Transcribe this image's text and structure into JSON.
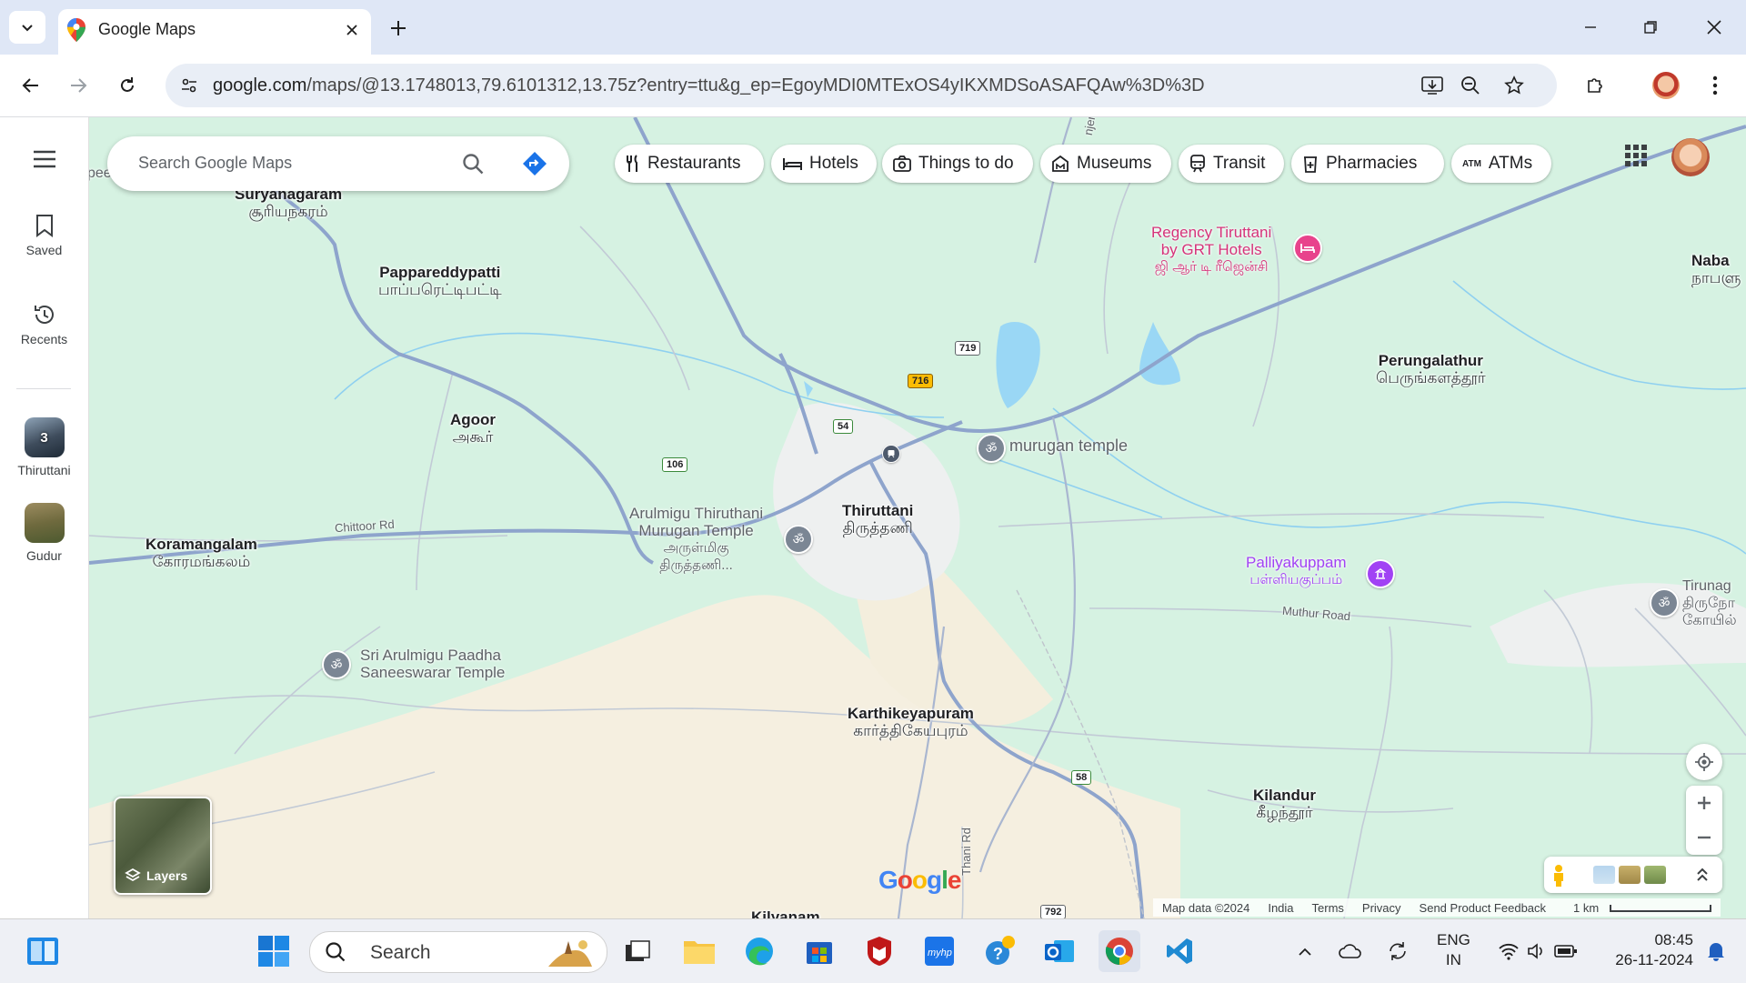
{
  "browser": {
    "tab_title": "Google Maps",
    "url_host": "google.com",
    "url_rest": "/maps/@13.1748013,79.6101312,13.75z?entry=ttu&g_ep=EgoyMDI0MTExOS4yIKXMDSoASAFQAw%3D%3D"
  },
  "rail": {
    "saved_label": "Saved",
    "recents_label": "Recents",
    "recent_places": [
      {
        "label": "Thiruttani",
        "count": "3"
      },
      {
        "label": "Gudur"
      }
    ]
  },
  "search": {
    "placeholder": "Search Google Maps"
  },
  "chips": [
    {
      "label": "Restaurants",
      "icon": "fork-knife-icon"
    },
    {
      "label": "Hotels",
      "icon": "bed-icon"
    },
    {
      "label": "Things to do",
      "icon": "camera-icon"
    },
    {
      "label": "Museums",
      "icon": "museum-icon"
    },
    {
      "label": "Transit",
      "icon": "train-icon"
    },
    {
      "label": "Pharmacies",
      "icon": "pharmacy-icon"
    },
    {
      "label": "ATMs",
      "icon": "atm-icon"
    }
  ],
  "map": {
    "places": [
      {
        "en": "Suryanagaram",
        "ta": "சூரியநகரம்"
      },
      {
        "en": "Pappareddypatti",
        "ta": "பாப்பரெட்டிபட்டி"
      },
      {
        "en": "Agoor",
        "ta": "அகூர்"
      },
      {
        "en": "Koramangalam",
        "ta": "கோரமங்கலம்"
      },
      {
        "en": "Thiruttani",
        "ta": "திருத்தணி"
      },
      {
        "en": "Karthikeyapuram",
        "ta": "கார்த்திகேயபுரம்"
      },
      {
        "en": "Perungalathur",
        "ta": "பெருங்களத்தூர்"
      },
      {
        "en": "Kilandur",
        "ta": "கீழந்தூர்"
      },
      {
        "en": "Naba",
        "ta": "நாபளு"
      },
      {
        "en": "Kilyanam",
        "ta": ""
      }
    ],
    "pois": {
      "peer_suraj": "peer suraj",
      "regency_1": "Regency Tiruttani",
      "regency_2": "by GRT Hotels",
      "regency_ta": "ஜி ஆர் டி ரீஜென்சி",
      "murugan_temple": "murugan temple",
      "arulmigu_1": "Arulmigu Thiruthani",
      "arulmigu_2": "Murugan Temple",
      "arulmigu_ta1": "அருள்மிகு",
      "arulmigu_ta2": "திருத்தணி...",
      "paadha_1": "Sri Arulmigu Paadha",
      "paadha_2": "Saneeswarar Temple",
      "palliyakuppam": "Palliyakuppam",
      "palliyakuppam_ta": "பள்ளியகுப்பம்",
      "tirunag": "Tirunag",
      "tirunag_ta1": "திருநாே",
      "tirunag_ta2": "கோயில்"
    },
    "road_labels": {
      "chittoor": "Chittoor Rd",
      "muthur": "Muthur Road",
      "thani": "Thani Rd",
      "njeri": "njeri"
    },
    "shields": [
      "716",
      "719",
      "54",
      "106",
      "58",
      "792"
    ],
    "colors": {
      "land": "#d6f2e2",
      "urban": "#f1f3f4",
      "sand": "#f5efe0",
      "road": "#8ea4cc",
      "water": "#9ad7f5"
    }
  },
  "attribution": {
    "map_data": "Map data ©2024",
    "country": "India",
    "terms": "Terms",
    "privacy": "Privacy",
    "feedback": "Send Product Feedback",
    "scale": "1 km"
  },
  "layers_label": "Layers",
  "google_logo": [
    "G",
    "o",
    "o",
    "g",
    "l",
    "e"
  ],
  "taskbar": {
    "search_label": "Search",
    "lang_1": "ENG",
    "lang_2": "IN",
    "time": "08:45",
    "date": "26-11-2024"
  }
}
